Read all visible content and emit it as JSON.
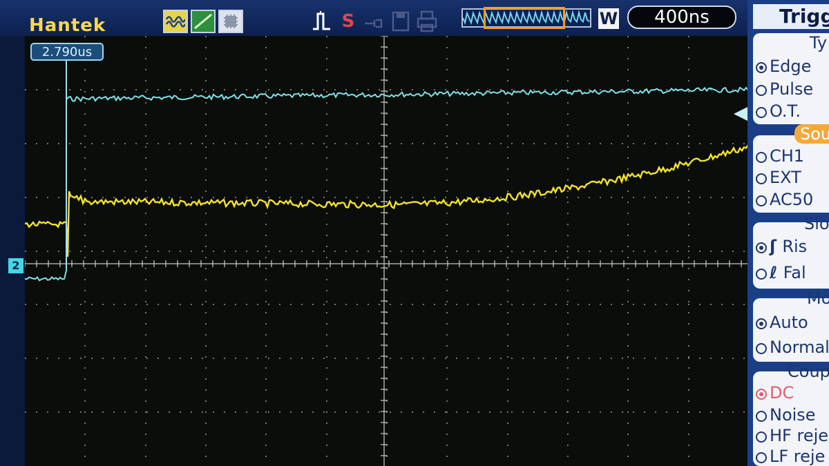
{
  "brand": {
    "name": "Hantek"
  },
  "toolbar": {
    "channel_icons": [
      "wave-icon",
      "ramp-icon",
      "chip-icon"
    ],
    "status_icons": [
      "pulse-icon",
      "s-icon",
      "probe-icon",
      "save-icon",
      "print-icon"
    ],
    "s_label": "S",
    "mode_label": "W",
    "timebase": "400ns"
  },
  "scope": {
    "cursor_time": "2.790us",
    "channel2_label": "2",
    "colors": {
      "ch1": "#f4e42b",
      "ch2": "#7fe2e9",
      "grid": "#cfd2cc",
      "background": "#0b0d0a"
    }
  },
  "trigger_menu": {
    "title": "Trigg",
    "type_head": "Ty",
    "types": [
      "Edge",
      "Pulse",
      "O.T."
    ],
    "selected_type": "Edge",
    "source_head": "Sou",
    "sources": [
      "CH1",
      "EXT",
      "AC50"
    ],
    "slope_head": "Slo",
    "slopes": [
      "Ris",
      "Fal"
    ],
    "selected_slope": "Ris",
    "mode_head": "Mo",
    "modes": [
      "Auto",
      "Normal"
    ],
    "selected_mode": "Auto",
    "coupling_head": "Coup",
    "couplings": [
      "DC",
      "Noise",
      "HF reje",
      "LF reje"
    ],
    "selected_coupling": "DC"
  }
}
